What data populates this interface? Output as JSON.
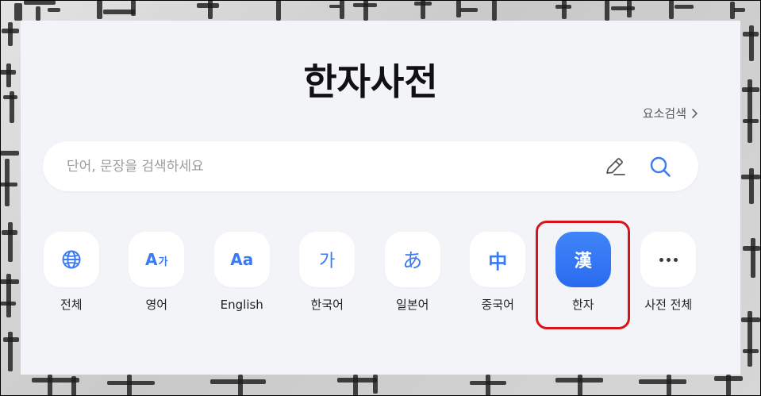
{
  "title": "한자사전",
  "element_search": {
    "label": "요소검색",
    "icon": "chevron-right-icon"
  },
  "search": {
    "placeholder": "단어, 문장을 검색하세요",
    "value": "",
    "handwriting_button_icon": "pen-icon",
    "search_button_icon": "search-icon"
  },
  "categories": [
    {
      "label": "전체",
      "icon": "globe-icon"
    },
    {
      "label": "영어",
      "icon": "english-korean-icon",
      "glyph": "A",
      "glyph_sub": "가"
    },
    {
      "label": "English",
      "icon": "english-icon",
      "glyph": "Aa"
    },
    {
      "label": "한국어",
      "icon": "korean-icon",
      "glyph": "가"
    },
    {
      "label": "일본어",
      "icon": "japanese-icon",
      "glyph": "あ"
    },
    {
      "label": "중국어",
      "icon": "chinese-icon",
      "glyph": "中"
    },
    {
      "label": "한자",
      "icon": "hanja-icon",
      "glyph": "漢",
      "selected": true
    },
    {
      "label": "사전 전체",
      "icon": "more-icon"
    }
  ],
  "annotation": {
    "type": "highlight-box",
    "target": "한자",
    "color": "#d7141c"
  },
  "colors": {
    "accent": "#3a7bf3",
    "panel": "#f3f4f8",
    "selected_bg": "#2f72f2",
    "highlight": "#d7141c"
  }
}
